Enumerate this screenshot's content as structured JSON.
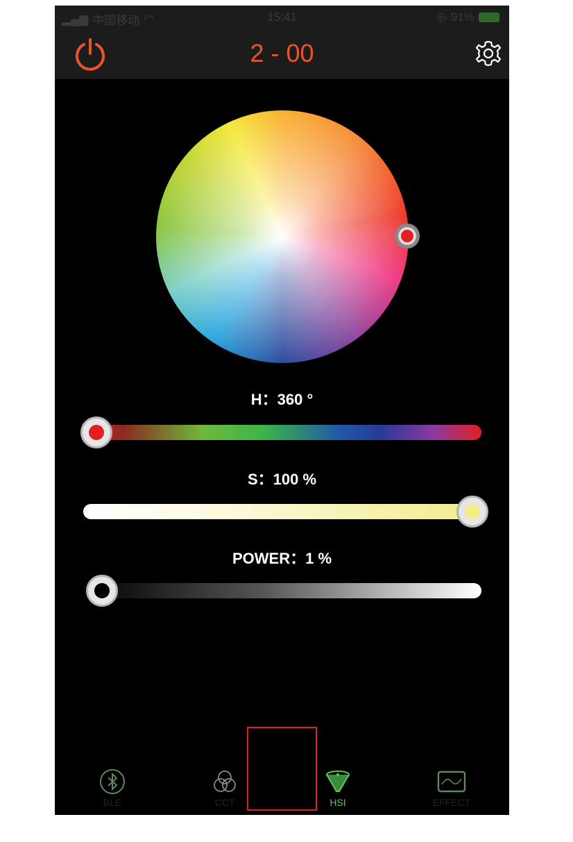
{
  "status_bar": {
    "carrier": "中国移动",
    "time": "15:41",
    "battery": "91%"
  },
  "header": {
    "title": "2 - 00",
    "power_icon": "power-icon",
    "settings_icon": "gear-icon"
  },
  "hue": {
    "label": "H：360 °",
    "value": 360,
    "max": 360
  },
  "saturation": {
    "label": "S：100 %",
    "value": 100,
    "max": 100
  },
  "power": {
    "label": "POWER：1 %",
    "value": 1,
    "max": 100
  },
  "tabs": [
    {
      "label": "BLE",
      "icon": "bluetooth-icon",
      "active": false
    },
    {
      "label": "CCT",
      "icon": "cct-circles-icon",
      "active": false
    },
    {
      "label": "HSI",
      "icon": "hsi-funnel-icon",
      "active": true
    },
    {
      "label": "EFFECT",
      "icon": "effect-monitor-icon",
      "active": false
    }
  ],
  "colors": {
    "accent": "#e8542c",
    "active_tab": "#5ec85a",
    "highlight_box": "#e02020"
  }
}
